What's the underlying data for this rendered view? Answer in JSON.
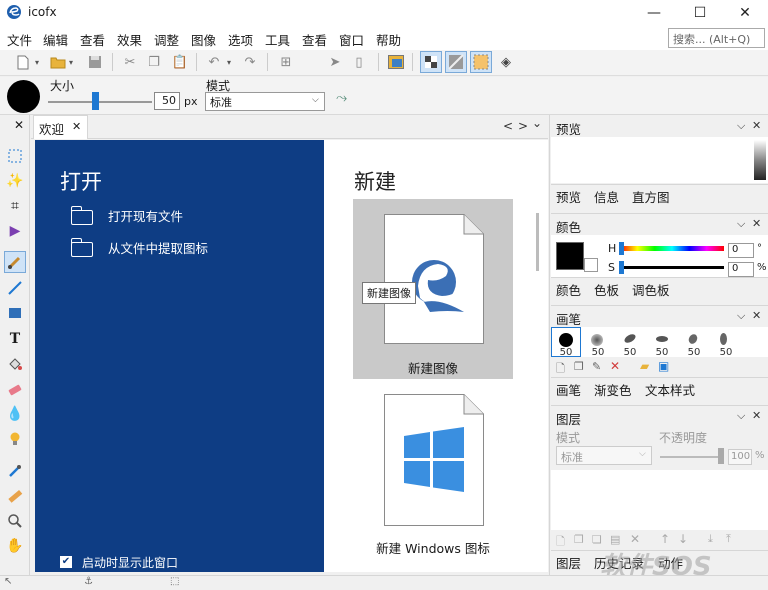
{
  "app": {
    "title": "icofx",
    "minimize": "—",
    "maximize": "☐",
    "close": "✕"
  },
  "menu": {
    "items": [
      "文件",
      "编辑",
      "查看",
      "效果",
      "调整",
      "图像",
      "选项",
      "工具",
      "查看",
      "窗口",
      "帮助"
    ],
    "search_placeholder": "搜索... (Alt+Q)"
  },
  "options_bar": {
    "size_label": "大小",
    "size_value": "50",
    "size_unit": "px",
    "size_level": 0.45,
    "mode_label": "模式",
    "mode_value": "标准"
  },
  "document_tab": {
    "label": "欢迎",
    "close": "✕",
    "prev": "<",
    "next": ">",
    "menu": "⌄"
  },
  "welcome": {
    "open_title": "打开",
    "open_links": [
      "打开现有文件",
      "从文件中提取图标"
    ],
    "new_title": "新建",
    "new_image_label": "新建图像",
    "new_windows_label": "新建 Windows 图标",
    "tooltip": "新建图像",
    "startup_label": "启动时显示此窗口",
    "startup_checked": true
  },
  "panels": {
    "preview": {
      "title": "预览",
      "tabs": [
        "预览",
        "信息",
        "直方图"
      ]
    },
    "color": {
      "title": "颜色",
      "h_label": "H",
      "h_value": "0",
      "h_unit": "°",
      "s_label": "S",
      "s_value": "0",
      "s_unit": "%",
      "tabs": [
        "颜色",
        "色板",
        "调色板"
      ]
    },
    "brush": {
      "title": "画笔",
      "sizes": [
        "50",
        "50",
        "50",
        "50",
        "50",
        "50"
      ],
      "tabs": [
        "画笔",
        "渐变色",
        "文本样式"
      ]
    },
    "layers": {
      "title": "图层",
      "mode_label": "模式",
      "mode_value": "标准",
      "opacity_label": "不透明度",
      "opacity_value": "100",
      "opacity_unit": "%",
      "tabs": [
        "图层",
        "历史记录",
        "动作"
      ]
    }
  },
  "watermark": "软件SOS",
  "colors": {
    "accent": "#1e78d2",
    "welcome_blue": "#0e3d84",
    "card_gray": "#c9c9c9",
    "selected_tool": "#cfe3f7"
  }
}
